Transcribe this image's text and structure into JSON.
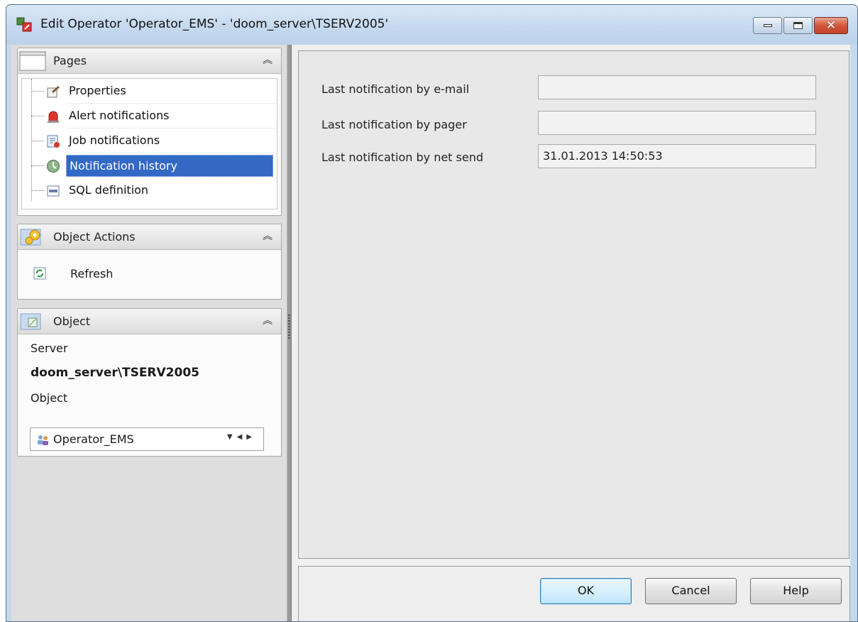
{
  "window": {
    "title": "Edit Operator 'Operator_EMS' - 'doom_server\\TSERV2005'",
    "icon": "edit-operator-icon",
    "buttons": [
      "minimize-icon",
      "maximize-icon",
      "close-icon"
    ]
  },
  "sidebar": {
    "pages": {
      "title": "Pages",
      "items": [
        {
          "label": "Properties",
          "icon": "properties-icon",
          "selected": false
        },
        {
          "label": "Alert notifications",
          "icon": "alert-icon",
          "selected": false
        },
        {
          "label": "Job notifications",
          "icon": "job-icon",
          "selected": false
        },
        {
          "label": "Notification history",
          "icon": "history-icon",
          "selected": true
        },
        {
          "label": "SQL definition",
          "icon": "sql-icon",
          "selected": false
        }
      ]
    },
    "object_actions": {
      "title": "Object Actions",
      "items": [
        {
          "label": "Refresh",
          "icon": "refresh-icon"
        }
      ]
    },
    "object": {
      "title": "Object",
      "server_label": "Server",
      "server_value": "doom_server\\TSERV2005",
      "object_label": "Object",
      "object_value": "Operator_EMS"
    }
  },
  "main": {
    "fields": [
      {
        "label": "Last notification by e-mail",
        "value": ""
      },
      {
        "label": "Last notification by pager",
        "value": ""
      },
      {
        "label": "Last notification by net send",
        "value": "31.01.2013 14:50:53"
      }
    ]
  },
  "footer": {
    "ok_label": "OK",
    "cancel_label": "Cancel",
    "help_label": "Help"
  },
  "colors": {
    "selection": "#3369c5",
    "titlebar": "#c4d8ee",
    "close_button": "#c2432a"
  }
}
